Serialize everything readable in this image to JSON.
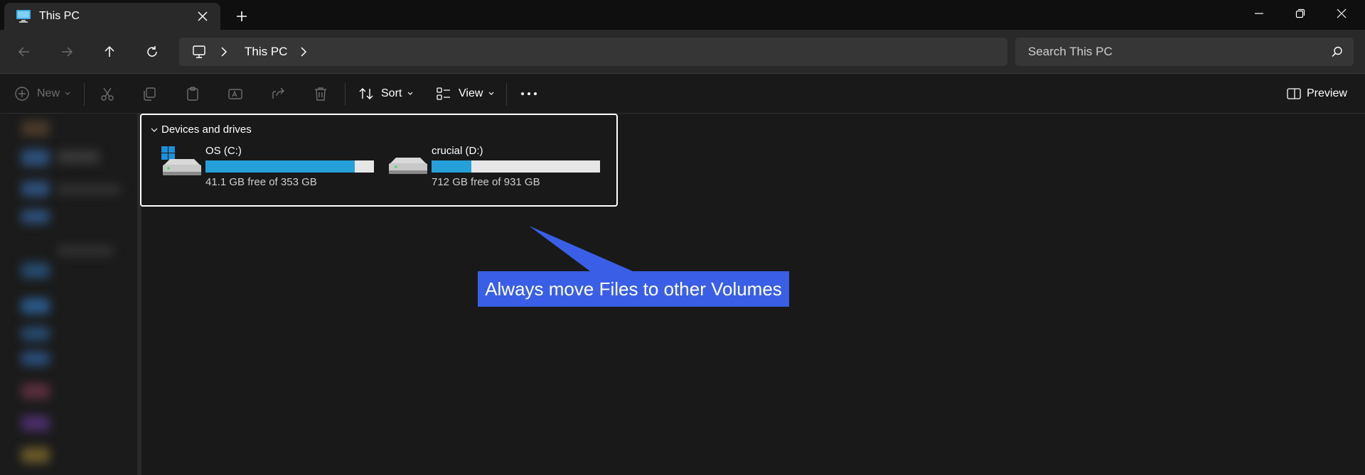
{
  "tab": {
    "title": "This PC",
    "icon": "monitor-icon"
  },
  "address": {
    "location": "This PC"
  },
  "search": {
    "placeholder": "Search This PC"
  },
  "toolbar": {
    "new_label": "New",
    "sort_label": "Sort",
    "view_label": "View",
    "preview_label": "Preview"
  },
  "group": {
    "title": "Devices and drives",
    "drives": [
      {
        "name": "OS (C:)",
        "free_text": "41.1 GB free of 353 GB",
        "used_fraction": 0.884
      },
      {
        "name": "crucial (D:)",
        "free_text": "712 GB free of 931 GB",
        "used_fraction": 0.235
      }
    ]
  },
  "callout": {
    "text": "Always move Files to other Volumes"
  },
  "colors": {
    "accent": "#26a0da",
    "callout": "#3a5fe6",
    "background": "#191919"
  }
}
